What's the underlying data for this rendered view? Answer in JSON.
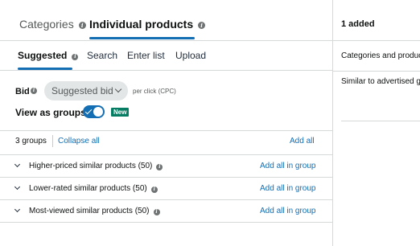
{
  "top_tabs": {
    "categories": "Categories",
    "individual_products": "Individual products"
  },
  "sub_tabs": {
    "suggested": "Suggested",
    "search": "Search",
    "enter_list": "Enter list",
    "upload": "Upload"
  },
  "bid": {
    "label": "Bid",
    "selected": "Suggested bid",
    "unit": "per click (CPC)"
  },
  "view_as_groups": {
    "label": "View as groups",
    "enabled": true,
    "badge": "New"
  },
  "groups_header": {
    "count": "3 groups",
    "collapse_all": "Collapse all",
    "add_all": "Add all"
  },
  "groups": [
    {
      "name": "Higher-priced similar products (50)",
      "action": "Add all in group"
    },
    {
      "name": "Lower-rated similar products (50)",
      "action": "Add all in group"
    },
    {
      "name": "Most-viewed similar products (50)",
      "action": "Add all in group"
    }
  ],
  "added_panel": {
    "title": "1 added",
    "column_header": "Categories and products",
    "row": "Similar to advertised goods"
  },
  "colors": {
    "accent": "#146eb4",
    "badge": "#067d62",
    "border": "#d5d9d9"
  }
}
